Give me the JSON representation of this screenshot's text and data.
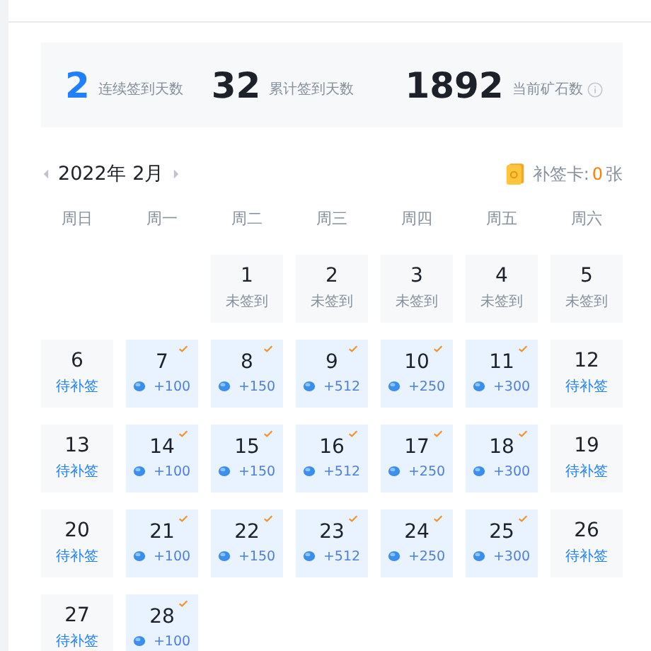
{
  "stats": [
    {
      "value": "2",
      "label": "连续签到天数",
      "highlight": true,
      "info": false
    },
    {
      "value": "32",
      "label": "累计签到天数",
      "highlight": false,
      "info": false
    },
    {
      "value": "1892",
      "label": "当前矿石数",
      "highlight": false,
      "info": true
    }
  ],
  "calendar": {
    "month": "2022年 2月",
    "card_label": "补签卡:",
    "card_count": "0",
    "card_unit": "张",
    "weekdays": [
      "周日",
      "周一",
      "周二",
      "周三",
      "周四",
      "周五",
      "周六"
    ],
    "weeks": [
      [
        {
          "kind": "empty"
        },
        {
          "kind": "empty"
        },
        {
          "kind": "unsigned",
          "day": "1",
          "label": "未签到"
        },
        {
          "kind": "unsigned",
          "day": "2",
          "label": "未签到"
        },
        {
          "kind": "unsigned",
          "day": "3",
          "label": "未签到"
        },
        {
          "kind": "unsigned",
          "day": "4",
          "label": "未签到"
        },
        {
          "kind": "unsigned",
          "day": "5",
          "label": "未签到"
        }
      ],
      [
        {
          "kind": "pending",
          "day": "6",
          "label": "待补签"
        },
        {
          "kind": "signed",
          "day": "7",
          "label": "+100"
        },
        {
          "kind": "signed",
          "day": "8",
          "label": "+150"
        },
        {
          "kind": "signed",
          "day": "9",
          "label": "+512"
        },
        {
          "kind": "signed",
          "day": "10",
          "label": "+250"
        },
        {
          "kind": "signed",
          "day": "11",
          "label": "+300"
        },
        {
          "kind": "pending",
          "day": "12",
          "label": "待补签"
        }
      ],
      [
        {
          "kind": "pending",
          "day": "13",
          "label": "待补签"
        },
        {
          "kind": "signed",
          "day": "14",
          "label": "+100"
        },
        {
          "kind": "signed",
          "day": "15",
          "label": "+150"
        },
        {
          "kind": "signed",
          "day": "16",
          "label": "+512"
        },
        {
          "kind": "signed",
          "day": "17",
          "label": "+250"
        },
        {
          "kind": "signed",
          "day": "18",
          "label": "+300"
        },
        {
          "kind": "pending",
          "day": "19",
          "label": "待补签"
        }
      ],
      [
        {
          "kind": "pending",
          "day": "20",
          "label": "待补签"
        },
        {
          "kind": "signed",
          "day": "21",
          "label": "+100"
        },
        {
          "kind": "signed",
          "day": "22",
          "label": "+150"
        },
        {
          "kind": "signed",
          "day": "23",
          "label": "+512"
        },
        {
          "kind": "signed",
          "day": "24",
          "label": "+250"
        },
        {
          "kind": "signed",
          "day": "25",
          "label": "+300"
        },
        {
          "kind": "pending",
          "day": "26",
          "label": "待补签"
        }
      ],
      [
        {
          "kind": "pending",
          "day": "27",
          "label": "待补签"
        },
        {
          "kind": "signed",
          "day": "28",
          "label": "+100"
        },
        {
          "kind": "empty"
        },
        {
          "kind": "empty"
        },
        {
          "kind": "empty"
        },
        {
          "kind": "empty"
        },
        {
          "kind": "empty"
        }
      ]
    ]
  }
}
